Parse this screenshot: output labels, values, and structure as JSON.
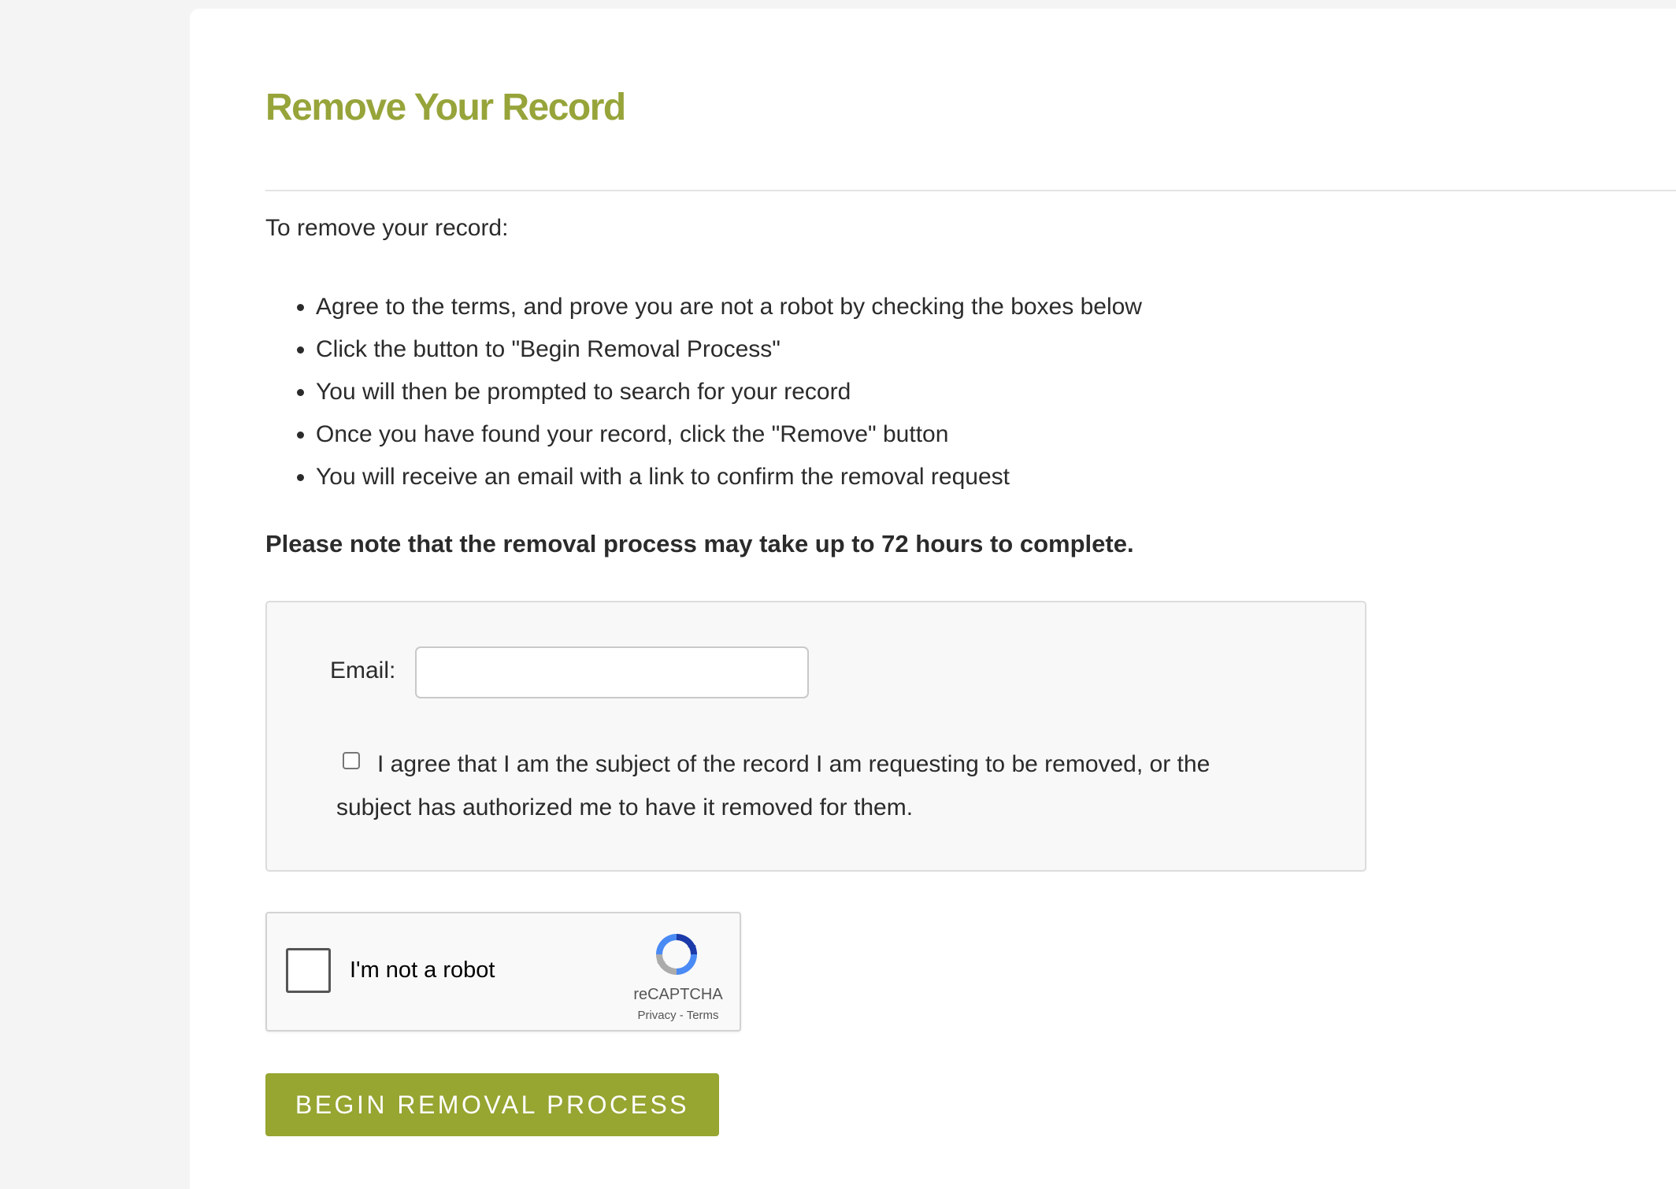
{
  "page": {
    "title": "Remove Your Record",
    "intro": "To remove your record:",
    "steps": [
      "Agree to the terms, and prove you are not a robot by checking the boxes below",
      "Click the button to \"Begin Removal Process\"",
      "You will then be prompted to search for your record",
      "Once you have found your record, click the \"Remove\" button",
      "You will receive an email with a link to confirm the removal request"
    ],
    "note": "Please note that the removal process may take up to 72 hours to complete."
  },
  "form": {
    "email_label": "Email:",
    "email_value": "",
    "email_placeholder": "",
    "agree_checked": false,
    "agree_text": "I agree that I am the subject of the record I am requesting to be removed, or the subject has authorized me to have it removed for them."
  },
  "recaptcha": {
    "checked": false,
    "label": "I'm not a robot",
    "brand": "reCAPTCHA",
    "privacy_link": "Privacy",
    "separator": " - ",
    "terms_link": "Terms"
  },
  "actions": {
    "begin_button": "BEGIN REMOVAL PROCESS"
  },
  "colors": {
    "accent": "#97a43a",
    "button": "#97a531",
    "panel_bg": "#f8f8f8",
    "page_bg": "#f4f4f4"
  }
}
